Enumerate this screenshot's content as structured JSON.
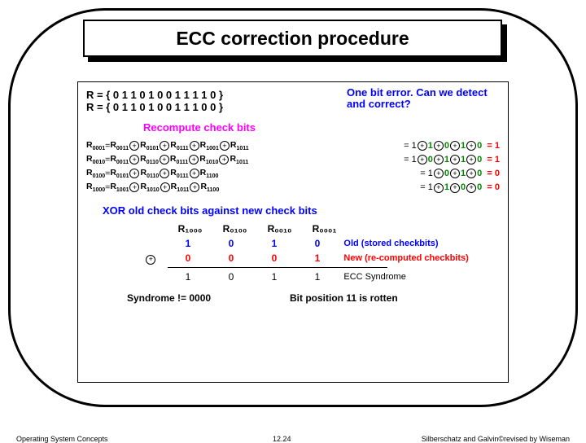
{
  "title": "ECC correction procedure",
  "r_lines": [
    "R = { 0 1 1 0 1 0 0 1 1 1 1 0 }",
    "R = { 0 1 1 0 1 0 0 1 1 1 0 0 }"
  ],
  "sidenote": "One bit error. Can we detect and correct?",
  "recompute": "Recompute check bits",
  "calc_rows": [
    {
      "lhs_sub": "0001",
      "terms": [
        "0011",
        "0101",
        "0111",
        "1001",
        "1011"
      ],
      "rhs_plain": "= 1",
      "gseq": [
        "1",
        "0",
        "1",
        "0"
      ],
      "res": "= 1"
    },
    {
      "lhs_sub": "0010",
      "terms": [
        "0011",
        "0110",
        "0111",
        "1010",
        "1011"
      ],
      "rhs_plain": "= 1",
      "gseq": [
        "0",
        "1",
        "1",
        "0"
      ],
      "res": "= 1"
    },
    {
      "lhs_sub": "0100",
      "terms": [
        "0101",
        "0110",
        "0111",
        "1100"
      ],
      "rhs_plain": "= 1",
      "gseq": [
        "0",
        "1",
        "0"
      ],
      "res": "= 0"
    },
    {
      "lhs_sub": "1000",
      "terms": [
        "1001",
        "1010",
        "1011",
        "1100"
      ],
      "rhs_plain": "= 1",
      "gseq": [
        "1",
        "0",
        "0"
      ],
      "res": "= 0"
    }
  ],
  "xor_line": "XOR old check bits against new check bits",
  "xor_table": {
    "headers": [
      "R₁₀₀₀",
      "R₀₁₀₀",
      "R₀₀₁₀",
      "R₀₀₀₁"
    ],
    "old": [
      "1",
      "0",
      "1",
      "0"
    ],
    "new": [
      "0",
      "0",
      "0",
      "1"
    ],
    "result": [
      "1",
      "0",
      "1",
      "1"
    ],
    "old_label": "Old (stored checkbits)",
    "new_label": "New (re-computed checkbits)",
    "syn_label": "ECC Syndrome"
  },
  "syndrome": {
    "left": "Syndrome != 0000",
    "right": "Bit position 11 is rotten"
  },
  "footer": {
    "left": "Operating System Concepts",
    "center": "12.24",
    "right": "Silberschatz and Galvin©revised by Wiseman"
  }
}
